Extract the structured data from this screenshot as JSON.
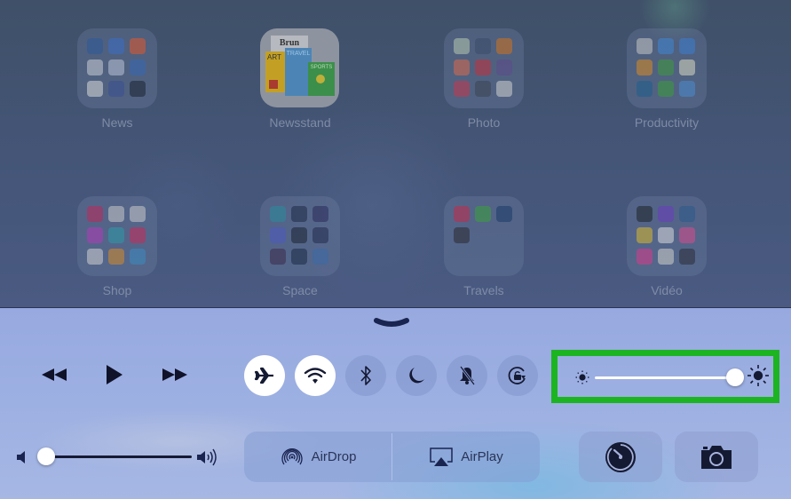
{
  "home": {
    "folders": [
      {
        "label": "News",
        "colors": [
          "#2e5a9a",
          "#3a6ec4",
          "#e2582c",
          "#c9cdd6",
          "#b9c3d6",
          "#3467b3",
          "#d8d8d8",
          "#3b4f93",
          "#1b2230"
        ]
      },
      {
        "label": "Photo",
        "colors": [
          "#b8c8b0",
          "#3a4a6a",
          "#d0731c",
          "#d86a4c",
          "#c4323a",
          "#5c4a8a",
          "#c7374c",
          "#3c4452",
          "#d0d0d0"
        ]
      },
      {
        "label": "Productivity",
        "colors": [
          "#c5c5c5",
          "#3f86d4",
          "#3b7ed0",
          "#d88a22",
          "#3c9a3c",
          "#d8d8c0",
          "#1e5f8e",
          "#3a9c3a",
          "#4a8ad0"
        ]
      },
      {
        "label": "Shop",
        "colors": [
          "#c0285a",
          "#c8c8c8",
          "#c8c8c8",
          "#b03ab8",
          "#2b9aa8",
          "#c82a58",
          "#d0d0d0",
          "#d48a2a",
          "#3a8ac0"
        ]
      },
      {
        "label": "Space",
        "colors": [
          "#2a8a9a",
          "#1e2a44",
          "#2a2a5a",
          "#4a5ac0",
          "#1a2232",
          "#222a4c",
          "#3a2a4a",
          "#1a2a44",
          "#3a6aa8"
        ]
      },
      {
        "label": "Travels",
        "colors": [
          "#c42a4a",
          "#3aa03a",
          "#1a3a6a",
          "#2a2a30"
        ]
      },
      {
        "label": "Vidéo",
        "colors": [
          "#1e2228",
          "#6a3ac0",
          "#2a5a8a",
          "#d8b82a",
          "#d8d8d8",
          "#d84a8a",
          "#d83a8a",
          "#d0d0c8",
          "#2a2e36"
        ]
      }
    ],
    "newsstand": {
      "label": "Newsstand",
      "papers": [
        "Brun",
        "ART",
        "TRAVEL",
        "SPORTS"
      ]
    }
  },
  "control_center": {
    "grabber_icon": "chevron-down-icon",
    "media": {
      "rewind_icon": "rewind-icon",
      "play_icon": "play-icon",
      "forward_icon": "fast-forward-icon"
    },
    "toggles": [
      {
        "name": "airplane-mode",
        "icon": "airplane-icon",
        "on": true
      },
      {
        "name": "wifi",
        "icon": "wifi-icon",
        "on": true
      },
      {
        "name": "bluetooth",
        "icon": "bluetooth-icon",
        "on": false
      },
      {
        "name": "do-not-disturb",
        "icon": "moon-icon",
        "on": false
      },
      {
        "name": "mute",
        "icon": "bell-slash-icon",
        "on": false
      },
      {
        "name": "rotation-lock",
        "icon": "rotation-lock-icon",
        "on": false
      }
    ],
    "brightness": {
      "value_percent": 100,
      "highlight_color": "#1db421"
    },
    "volume": {
      "value_percent": 0
    },
    "share": {
      "airdrop_label": "AirDrop",
      "airplay_label": "AirPlay"
    },
    "utilities": [
      {
        "name": "timer",
        "icon": "timer-icon"
      },
      {
        "name": "camera",
        "icon": "camera-icon"
      }
    ]
  }
}
